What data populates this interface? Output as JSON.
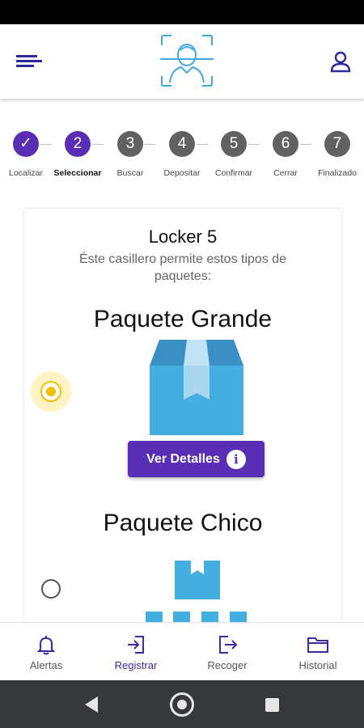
{
  "header": {
    "logo_icon": "face-scan-logo-icon",
    "menu_icon": "menu-icon",
    "account_icon": "user-icon"
  },
  "stepper": {
    "steps": [
      {
        "number": "",
        "label": "Localizar",
        "state": "done"
      },
      {
        "number": "2",
        "label": "Seleccionar",
        "state": "active"
      },
      {
        "number": "3",
        "label": "Buscar",
        "state": "pending"
      },
      {
        "number": "4",
        "label": "Depositar",
        "state": "pending"
      },
      {
        "number": "5",
        "label": "Confirmar",
        "state": "pending"
      },
      {
        "number": "6",
        "label": "Cerrar",
        "state": "pending"
      },
      {
        "number": "7",
        "label": "Finalizado",
        "state": "pending"
      }
    ],
    "check_glyph": "✓"
  },
  "locker": {
    "title": "Locker 5",
    "description": "Éste casillero permite estos tipos de paquetes:"
  },
  "packages": [
    {
      "name": "Paquete Grande",
      "selected": true,
      "details_label": "Ver Detalles",
      "info_glyph": "i"
    },
    {
      "name": "Paquete Chico",
      "selected": false
    }
  ],
  "bottom_nav": [
    {
      "label": "Alertas",
      "icon": "bell-icon",
      "active": false
    },
    {
      "label": "Registrar",
      "icon": "login-icon",
      "active": true
    },
    {
      "label": "Recoger",
      "icon": "logout-icon",
      "active": false
    },
    {
      "label": "Historial",
      "icon": "folder-icon",
      "active": false
    }
  ],
  "colors": {
    "primary": "#5a2db5",
    "accent": "#f2c200",
    "box": "#43aee0",
    "inactive_step": "#616161",
    "logo": "#3fa9e6"
  }
}
